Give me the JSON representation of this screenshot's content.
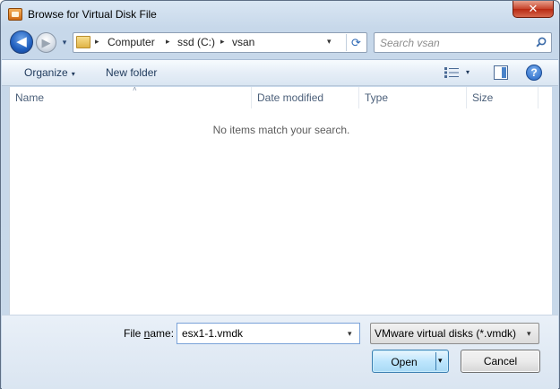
{
  "window": {
    "title": "Browse for Virtual Disk File",
    "close_label": "✕"
  },
  "nav": {
    "back_glyph": "◀",
    "forward_glyph": "▶",
    "recent_glyph": "▾"
  },
  "address": {
    "crumbs": [
      "Computer",
      "ssd (C:)",
      "vsan"
    ],
    "separator": "▸",
    "dropdown_glyph": "▾",
    "refresh_glyph": "⟳"
  },
  "search": {
    "placeholder": "Search vsan"
  },
  "toolbar": {
    "organize_label": "Organize",
    "new_folder_label": "New folder",
    "dropdown_glyph": "▾",
    "help_glyph": "?"
  },
  "file_list": {
    "columns": [
      "Name",
      "Date modified",
      "Type",
      "Size"
    ],
    "sort_glyph": "˄",
    "empty_message": "No items match your search."
  },
  "bottom": {
    "filename_label_pre": "File ",
    "filename_label_underline": "n",
    "filename_label_post": "ame:",
    "filename_value": "esx1-1.vmdk",
    "filter_value": "VMware virtual disks (*.vmdk)",
    "open_label": "Open",
    "cancel_label": "Cancel",
    "dropdown_glyph": "▾"
  },
  "colors": {
    "accent": "#1f5fbf",
    "frame": "#c9d9ea",
    "close_red": "#c7432b"
  }
}
